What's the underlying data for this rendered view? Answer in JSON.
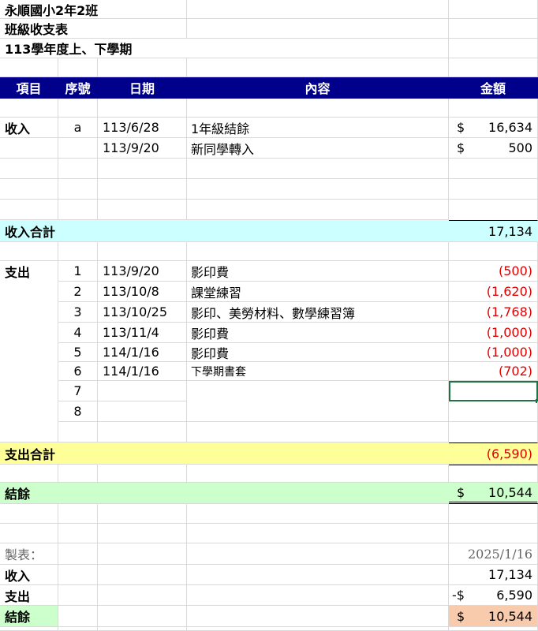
{
  "header_lines": [
    "永順國小2年2班",
    "班級收支表",
    "113學年度上、下學期"
  ],
  "columns": [
    "項目",
    "序號",
    "日期",
    "內容",
    "金額"
  ],
  "income": {
    "label": "收入",
    "rows": [
      {
        "seq": "a",
        "date": "113/6/28",
        "desc": "1年級結餘",
        "currency": "$",
        "amount": "16,634"
      },
      {
        "seq": "",
        "date": "113/9/20",
        "desc": "新同學轉入",
        "currency": "$",
        "amount": "500"
      }
    ],
    "total_label": "收入合計",
    "total": "17,134"
  },
  "expense": {
    "label": "支出",
    "rows": [
      {
        "seq": "1",
        "date": "113/9/20",
        "desc": "影印費",
        "amount": "(500)"
      },
      {
        "seq": "2",
        "date": "113/10/8",
        "desc": "課堂練習",
        "amount": "(1,620)"
      },
      {
        "seq": "3",
        "date": "113/10/25",
        "desc": "影印、美勞材料、數學練習簿",
        "amount": "(1,768)"
      },
      {
        "seq": "4",
        "date": "113/11/4",
        "desc": "影印費",
        "amount": "(1,000)"
      },
      {
        "seq": "5",
        "date": "114/1/16",
        "desc": "影印費",
        "amount": "(1,000)"
      },
      {
        "seq": "6",
        "date": "114/1/16",
        "desc": "下學期書套",
        "amount": "(702)"
      },
      {
        "seq": "7",
        "date": "",
        "desc": "",
        "amount": ""
      },
      {
        "seq": "8",
        "date": "",
        "desc": "",
        "amount": ""
      }
    ],
    "total_label": "支出合計",
    "total": "(6,590)"
  },
  "balance": {
    "label": "結餘",
    "currency": "$",
    "amount": "10,544"
  },
  "summary": {
    "made_by_label": "製表：",
    "date": "2025/1/16",
    "income_label": "收入",
    "income": "17,134",
    "expense_label": "支出",
    "expense_currency": "-$",
    "expense": "6,590",
    "balance_label": "結餘",
    "balance_currency": "$",
    "balance": "10,544"
  },
  "colors": {
    "header_bg": "#00008b",
    "income_total_bg": "#ccffff",
    "expense_total_bg": "#ffff99",
    "balance_bg": "#ccffcc",
    "negative": "#e00000",
    "final_balance_bg": "#f8cbad"
  }
}
